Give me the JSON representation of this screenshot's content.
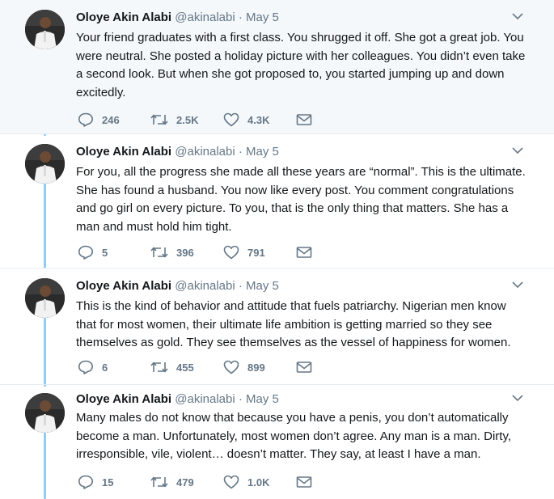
{
  "author": {
    "name": "Oloye Akin Alabi",
    "handle": "@akinalabi"
  },
  "tweets": [
    {
      "date": "May 5",
      "text": "Your friend graduates with a first class. You shrugged it off. She got a great job. You were neutral. She posted a holiday picture with her colleagues. You didn’t even take a second look. But when she got proposed to, you started jumping up and down excitedly.",
      "replies": "246",
      "retweets": "2.5K",
      "likes": "4.3K"
    },
    {
      "date": "May 5",
      "text": "For you, all the progress she made all these years are “normal”. This is the ultimate. She has found a husband. You now like every post. You comment congratulations and go girl on every picture. To you, that is the only thing that matters. She has a man and must hold him tight.",
      "replies": "5",
      "retweets": "396",
      "likes": "791"
    },
    {
      "date": "May 5",
      "text": "This is the kind of behavior and attitude that fuels patriarchy. Nigerian men know that for most women, their ultimate life ambition is getting married so they see themselves as gold. They see themselves as the vessel of happiness for women.",
      "replies": "6",
      "retweets": "455",
      "likes": "899"
    },
    {
      "date": "May 5",
      "text": "Many males do not know that because you have a penis, you don’t automatically become a man. Unfortunately, most women don’t agree. Any man is a man. Dirty, irresponsible, vile, violent… doesn’t matter. They say, at least I have a man.",
      "replies": "15",
      "retweets": "479",
      "likes": "1.0K"
    }
  ],
  "icons": {
    "reply": "reply-icon",
    "retweet": "retweet-icon",
    "like": "heart-icon",
    "dm": "envelope-icon",
    "menu": "chevron-down-icon"
  },
  "colors": {
    "thread_line": "#8ecdf8",
    "muted": "#657786",
    "highlight_bg": "#f5f8fa"
  }
}
